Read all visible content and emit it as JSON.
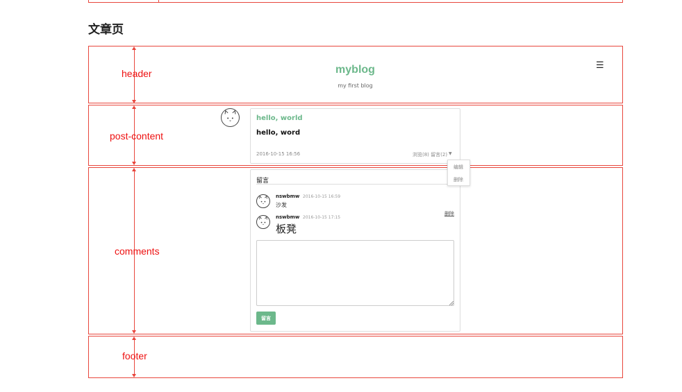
{
  "page": {
    "section_title": "文章页"
  },
  "regions": {
    "header": "header",
    "post_content": "post-content",
    "comments": "comments",
    "footer": "footer"
  },
  "site": {
    "title": "myblog",
    "subtitle": "my first blog",
    "menu_icon": "hamburger-menu-icon"
  },
  "post": {
    "title": "hello, world",
    "body": "hello, word",
    "date": "2016-10-15 16:56",
    "stats": "浏览(8) 留言(2)",
    "menu": {
      "edit": "编辑",
      "delete": "删除"
    }
  },
  "comments": {
    "heading": "留言",
    "items": [
      {
        "user": "nswbmw",
        "time": "2016-10-15 16:59",
        "text": "沙发"
      },
      {
        "user": "nswbmw",
        "time": "2016-10-15 17:15",
        "text": "板凳",
        "delete_label": "删除"
      }
    ],
    "input_value": "",
    "submit_label": "留言"
  },
  "colors": {
    "annotation": "#e8463c",
    "label": "#ee1111",
    "accent": "#6cb88b"
  }
}
